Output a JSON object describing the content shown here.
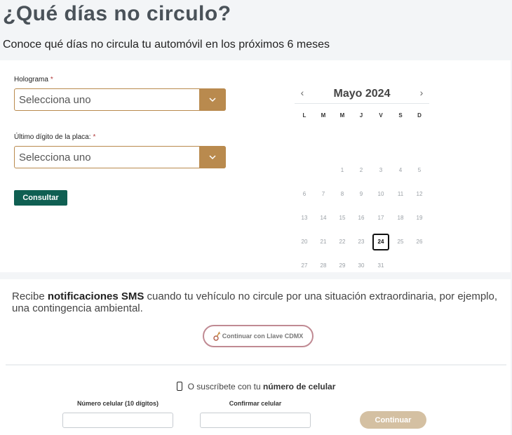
{
  "header": {
    "title": "¿Qué días no circulo?",
    "subtitle": "Conoce qué días no circula tu automóvil en los próximos 6 meses"
  },
  "form": {
    "holograma": {
      "label": "Holograma",
      "required": "*",
      "value": "Selecciona uno",
      "icon": "chevron-down-icon"
    },
    "placa": {
      "label": "Último dígito de la placa:",
      "required": "*",
      "value": "Selecciona uno",
      "icon": "chevron-down-icon"
    },
    "submit_label": "Consultar"
  },
  "calendar": {
    "title": "Mayo 2024",
    "prev": "‹",
    "next": "›",
    "weekdays": [
      "L",
      "M",
      "M",
      "J",
      "V",
      "S",
      "D"
    ],
    "first_weekday_index": 2,
    "days_in_month": 31,
    "today": 24
  },
  "sms": {
    "text_prefix": "Recibe ",
    "text_bold": "notificaciones SMS",
    "text_suffix": " cuando tu vehículo no circule por una situación extraordinaria, por ejemplo, una contingencia ambiental.",
    "llave_label": "Continuar con Llave CDMX",
    "subscribe_prefix": "O suscríbete con tu ",
    "subscribe_bold": "número de celular",
    "phone_label": "Número celular (10 dígitos)",
    "phone_value": "",
    "confirm_label": "Confirmar celular",
    "confirm_value": "",
    "continue_label": "Continuar"
  },
  "colors": {
    "accent_gold": "#b98a4e",
    "primary_green": "#0f5f52",
    "llave_border": "#c08a93",
    "continue_disabled": "#d4c0a2"
  }
}
